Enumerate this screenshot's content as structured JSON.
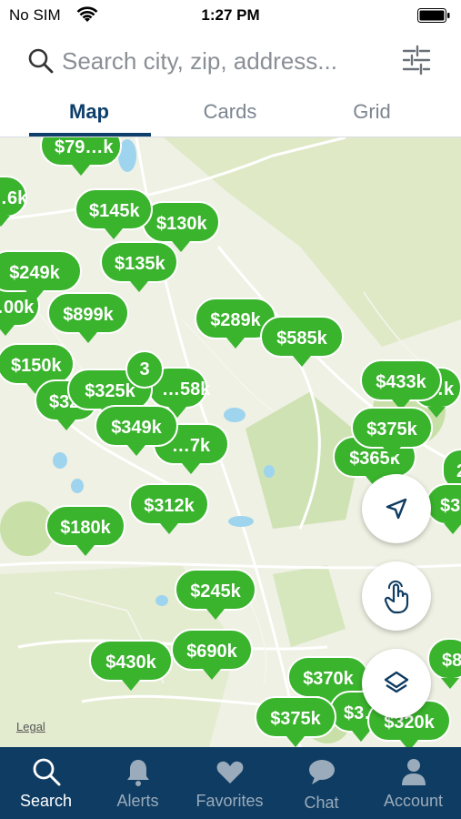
{
  "status_bar": {
    "carrier": "No SIM",
    "time": "1:27 PM"
  },
  "search": {
    "placeholder": "Search city, zip, address..."
  },
  "tabs": [
    {
      "label": "Map",
      "active": true
    },
    {
      "label": "Cards",
      "active": false
    },
    {
      "label": "Grid",
      "active": false
    }
  ],
  "map": {
    "legal_label": "Legal",
    "cluster_count": "3",
    "pins": [
      "$79…k",
      "…6k",
      "$145k",
      "$130k",
      "$249k",
      "$135k",
      "…00k",
      "$899k",
      "$289k",
      "$585k",
      "$150k",
      "$325k",
      "…58k",
      "$32…",
      "$349k",
      "…7k",
      "$433k",
      "…k",
      "$375k",
      "$365k",
      "$312k",
      "$180k",
      "$245k",
      "$690k",
      "$430k",
      "$370k",
      "$375k",
      "$3…",
      "$320k",
      "$8…",
      "$32…",
      "2…"
    ]
  },
  "map_controls": [
    "location-arrow-icon",
    "touch-draw-icon",
    "layers-icon"
  ],
  "bottom_nav": [
    {
      "label": "Search",
      "icon": "search-icon",
      "active": true
    },
    {
      "label": "Alerts",
      "icon": "bell-icon",
      "active": false
    },
    {
      "label": "Favorites",
      "icon": "heart-icon",
      "active": false
    },
    {
      "label": "Chat",
      "icon": "chat-icon",
      "active": false
    },
    {
      "label": "Account",
      "icon": "person-icon",
      "active": false
    }
  ],
  "colors": {
    "brand_navy": "#0f3c62",
    "pin_green": "#3ab32d",
    "tab_active": "#0e3f6a"
  }
}
